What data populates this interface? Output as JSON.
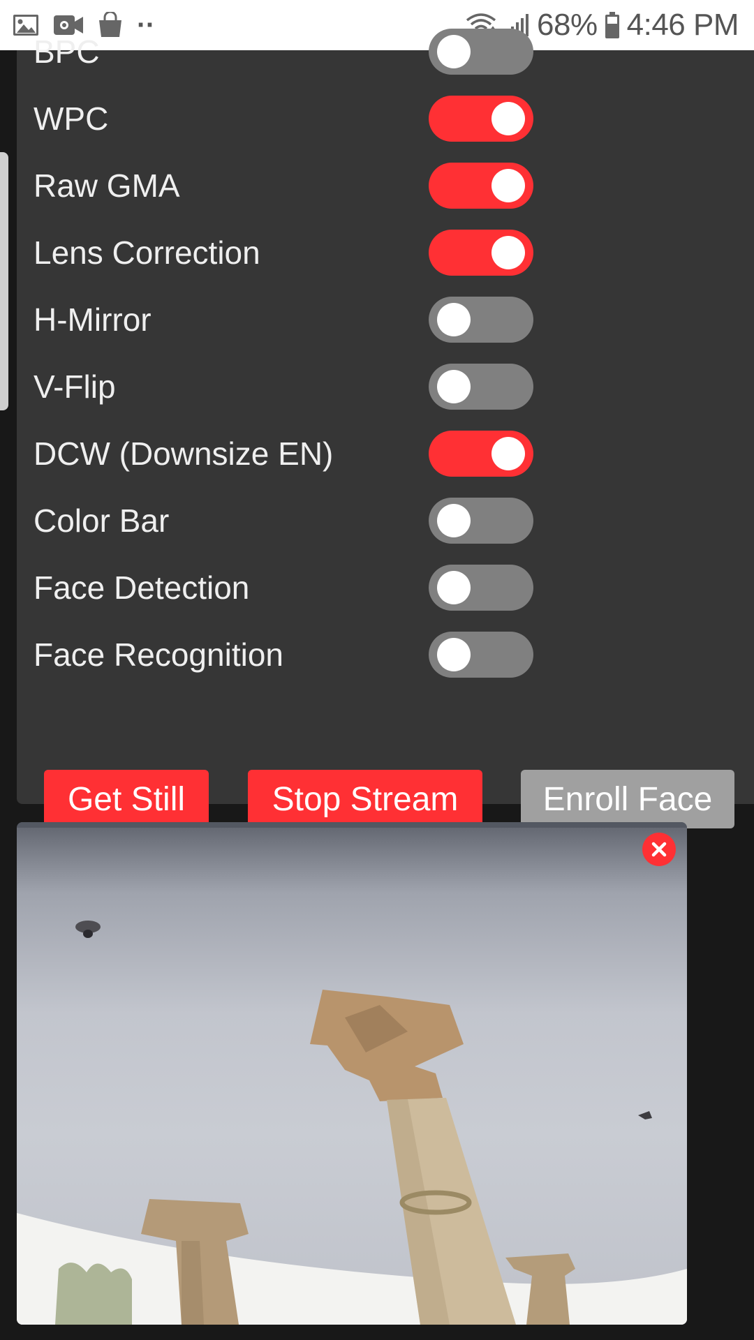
{
  "status_bar": {
    "battery": "68%",
    "time": "4:46 PM",
    "overflow_dots": "··",
    "icons": [
      "image-icon",
      "video-camera-icon",
      "shopping-bag-icon",
      "wifi-icon",
      "signal-icon",
      "battery-icon"
    ]
  },
  "settings": {
    "toggles": [
      {
        "label": "BPC",
        "on": false
      },
      {
        "label": "WPC",
        "on": true
      },
      {
        "label": "Raw GMA",
        "on": true
      },
      {
        "label": "Lens Correction",
        "on": true
      },
      {
        "label": "H-Mirror",
        "on": false
      },
      {
        "label": "V-Flip",
        "on": false
      },
      {
        "label": "DCW (Downsize EN)",
        "on": true
      },
      {
        "label": "Color Bar",
        "on": false
      },
      {
        "label": "Face Detection",
        "on": false
      },
      {
        "label": "Face Recognition",
        "on": false
      }
    ]
  },
  "buttons": {
    "get_still": "Get Still",
    "stop_stream": "Stop Stream",
    "enroll_face": "Enroll Face"
  },
  "stream": {
    "close_icon": "close-icon"
  },
  "colors": {
    "accent": "#ff3034",
    "toggle_off": "#808080",
    "panel_bg": "#363636",
    "page_bg": "#181818"
  }
}
